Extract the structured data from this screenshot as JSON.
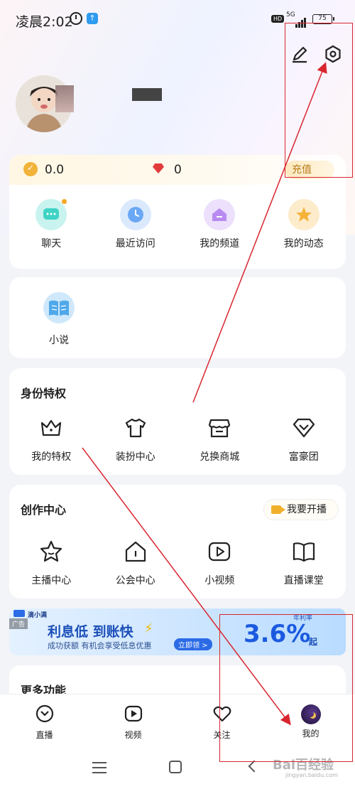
{
  "status_bar": {
    "time": "凌晨2:02",
    "hd": "HD",
    "network": "5G",
    "battery": "75",
    "up_icon": "↑"
  },
  "header": {
    "edit_icon": "edit-icon",
    "settings_icon": "settings-icon"
  },
  "wallet": {
    "coins": "0.0",
    "gems": "0",
    "recharge_label": "充值"
  },
  "quick_actions": [
    {
      "label": "聊天",
      "icon": "chat-icon",
      "color": "#3fd3c4"
    },
    {
      "label": "最近访问",
      "icon": "clock-icon",
      "color": "#6aa8f5"
    },
    {
      "label": "我的频道",
      "icon": "home-icon",
      "color": "#b98bf2"
    },
    {
      "label": "我的动态",
      "icon": "star-icon",
      "color": "#f5b23a"
    }
  ],
  "novel": {
    "label": "小说",
    "icon": "book-icon"
  },
  "privileges": {
    "title": "身份特权",
    "items": [
      {
        "label": "我的特权",
        "icon": "crown-icon"
      },
      {
        "label": "装扮中心",
        "icon": "shirt-icon"
      },
      {
        "label": "兑换商城",
        "icon": "shop-icon"
      },
      {
        "label": "富豪团",
        "icon": "diamond-icon"
      }
    ]
  },
  "creator": {
    "title": "创作中心",
    "live_button": "我要开播",
    "items": [
      {
        "label": "主播中心",
        "icon": "star-outline-icon"
      },
      {
        "label": "公会中心",
        "icon": "guild-icon"
      },
      {
        "label": "小视频",
        "icon": "play-icon"
      },
      {
        "label": "直播课堂",
        "icon": "book-open-icon"
      }
    ]
  },
  "ad": {
    "tag": "广告",
    "brand": "滴小满",
    "headline": "利息低 到账快",
    "sub": "成功获额 有机会享受低息优惠",
    "cta": "立即领 >",
    "rate_label": "年利率",
    "rate": "3.6%",
    "rate_suffix": "起"
  },
  "more": {
    "title": "更多功能"
  },
  "tabs": [
    {
      "label": "直播",
      "icon": "live-icon"
    },
    {
      "label": "视频",
      "icon": "video-icon"
    },
    {
      "label": "关注",
      "icon": "heart-icon"
    },
    {
      "label": "我的",
      "icon": "avatar-icon"
    }
  ],
  "watermark": {
    "main": "Bai百经验",
    "sub": "jingyan.baidu.com"
  },
  "colors": {
    "annotation": "#d8262f",
    "accent": "#f5a623"
  }
}
